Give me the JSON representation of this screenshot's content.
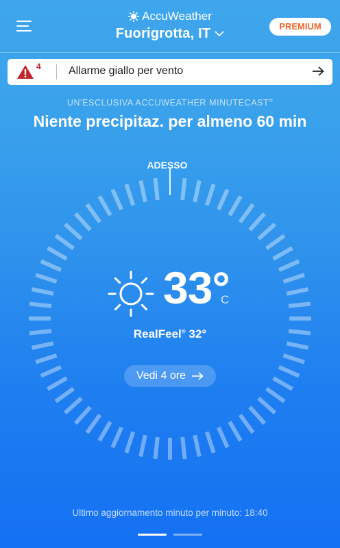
{
  "header": {
    "brand": "AccuWeather",
    "location": "Fuorigrotta, IT",
    "premium_label": "PREMIUM"
  },
  "alert": {
    "count": "4",
    "text": "Allarme giallo per vento",
    "color": "#c0272d"
  },
  "minutecast": {
    "label": "UN'ESCLUSIVA ACCUWEATHER MINUTECAST",
    "headline": "Niente precipitaz. per almeno 60 min",
    "now_label": "ADESSO"
  },
  "current": {
    "temperature": "33°",
    "unit": "C",
    "realfeel_label": "RealFeel",
    "realfeel_value": "32°",
    "condition_icon": "sun-icon"
  },
  "actions": {
    "hourly_label": "Vedi 4 ore"
  },
  "footer": {
    "updated_text": "Ultimo aggiornamento minuto per minuto: 18:40"
  },
  "pager": {
    "pages": 2,
    "active": 0
  },
  "colors": {
    "premium_text": "#e8662a",
    "background_top": "#3fa6ec",
    "background_bottom": "#1470f2"
  }
}
